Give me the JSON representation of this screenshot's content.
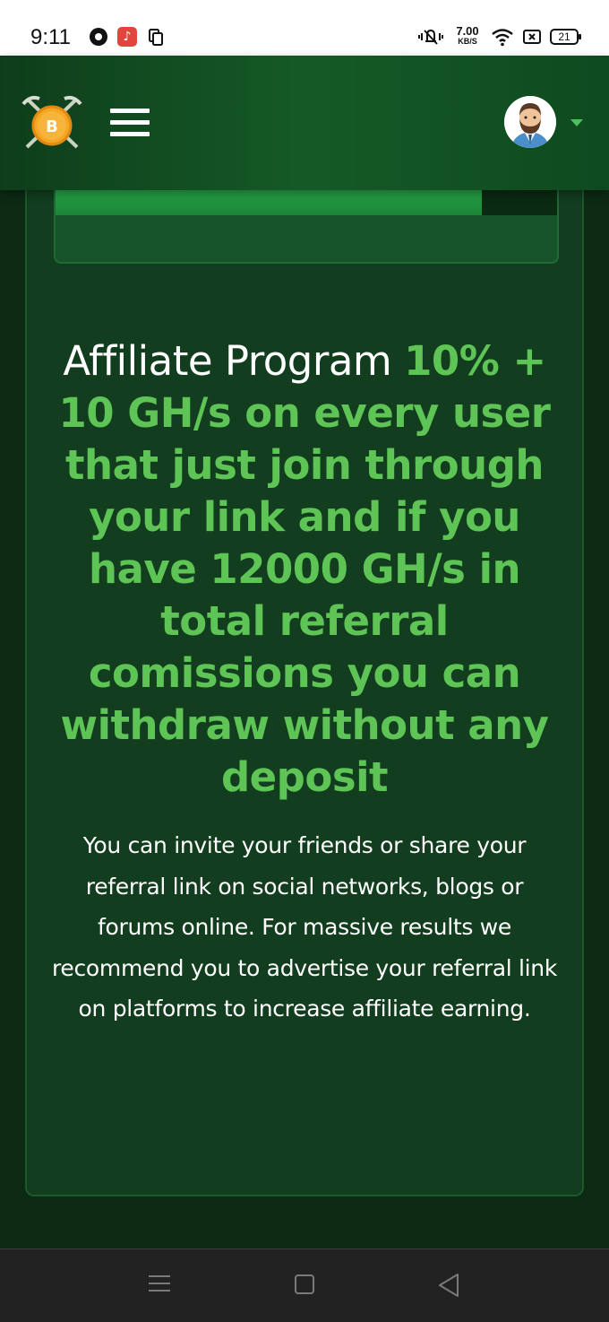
{
  "status_bar": {
    "time": "9:11",
    "speed_value": "7.00",
    "speed_unit": "KB/S",
    "battery": "21",
    "icons": [
      "chrome-icon",
      "music-app-icon",
      "copy-icon",
      "mute-icon",
      "wifi-icon",
      "sim-icon",
      "battery-icon"
    ]
  },
  "header": {
    "logo_icon": "bitcoin-pickaxe-logo",
    "menu_icon": "hamburger-menu-icon",
    "avatar_icon": "user-avatar",
    "caret_icon": "caret-down-icon",
    "caret_color": "#4cc35a"
  },
  "main": {
    "progress_fraction": 0.85,
    "heading_white": "Affiliate Program ",
    "heading_green": "10% + 10 GH/s on every user that just join through your link and if you have 12000 GH/s in total referral comissions you can withdraw without any deposit",
    "body": "You can invite your friends or share your referral link on social networks, blogs or forums online. For massive results we recommend you to advertise your referral link on platforms to increase affiliate earning."
  },
  "colors": {
    "accent_green": "#5ec456",
    "background": "#0c2a14",
    "card": "#123d1e",
    "header": "#155a26"
  },
  "nav_bar": {
    "icons": [
      "nav-menu-icon",
      "nav-home-icon",
      "nav-back-icon"
    ]
  }
}
